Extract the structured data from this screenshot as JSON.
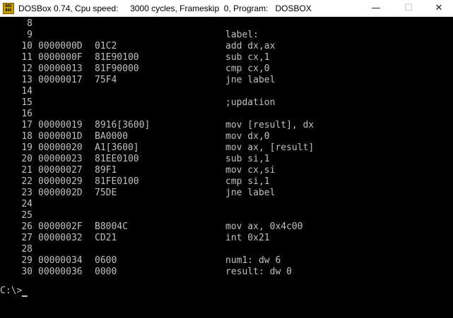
{
  "window": {
    "title": "DOSBox 0.74, Cpu speed:     3000 cycles, Frameskip  0, Program:   DOSBOX",
    "icon_text": [
      "DOS",
      "BOX"
    ],
    "controls": {
      "minimize": "—",
      "maximize": "☐",
      "close": "✕"
    }
  },
  "listing": [
    {
      "n": "8",
      "addr": "",
      "code": "",
      "src": ""
    },
    {
      "n": "9",
      "addr": "",
      "code": "",
      "src": "label:"
    },
    {
      "n": "10",
      "addr": "0000000D",
      "code": "01C2",
      "src": "add dx,ax"
    },
    {
      "n": "11",
      "addr": "0000000F",
      "code": "81E90100",
      "src": "sub cx,1"
    },
    {
      "n": "12",
      "addr": "00000013",
      "code": "81F90000",
      "src": "cmp cx,0"
    },
    {
      "n": "13",
      "addr": "00000017",
      "code": "75F4",
      "src": "jne label"
    },
    {
      "n": "14",
      "addr": "",
      "code": "",
      "src": ""
    },
    {
      "n": "15",
      "addr": "",
      "code": "",
      "src": ";updation"
    },
    {
      "n": "16",
      "addr": "",
      "code": "",
      "src": ""
    },
    {
      "n": "17",
      "addr": "00000019",
      "code": "8916[3600]",
      "src": "mov [result], dx"
    },
    {
      "n": "18",
      "addr": "0000001D",
      "code": "BA0000",
      "src": "mov dx,0"
    },
    {
      "n": "19",
      "addr": "00000020",
      "code": "A1[3600]",
      "src": "mov ax, [result]"
    },
    {
      "n": "20",
      "addr": "00000023",
      "code": "81EE0100",
      "src": "sub si,1"
    },
    {
      "n": "21",
      "addr": "00000027",
      "code": "89F1",
      "src": "mov cx,si"
    },
    {
      "n": "22",
      "addr": "00000029",
      "code": "81FE0100",
      "src": "cmp si,1"
    },
    {
      "n": "23",
      "addr": "0000002D",
      "code": "75DE",
      "src": "jne label"
    },
    {
      "n": "24",
      "addr": "",
      "code": "",
      "src": ""
    },
    {
      "n": "25",
      "addr": "",
      "code": "",
      "src": ""
    },
    {
      "n": "26",
      "addr": "0000002F",
      "code": "B8004C",
      "src": "mov ax, 0x4c00"
    },
    {
      "n": "27",
      "addr": "00000032",
      "code": "CD21",
      "src": "int 0x21"
    },
    {
      "n": "28",
      "addr": "",
      "code": "",
      "src": ""
    },
    {
      "n": "29",
      "addr": "00000034",
      "code": "0600",
      "src": "num1: dw 6"
    },
    {
      "n": "30",
      "addr": "00000036",
      "code": "0000",
      "src": "result: dw 0"
    }
  ],
  "prompt": "C:\\>",
  "colors": {
    "terminal_bg": "#000000",
    "terminal_fg": "#c0c0c0",
    "titlebar_bg": "#ffffff"
  }
}
